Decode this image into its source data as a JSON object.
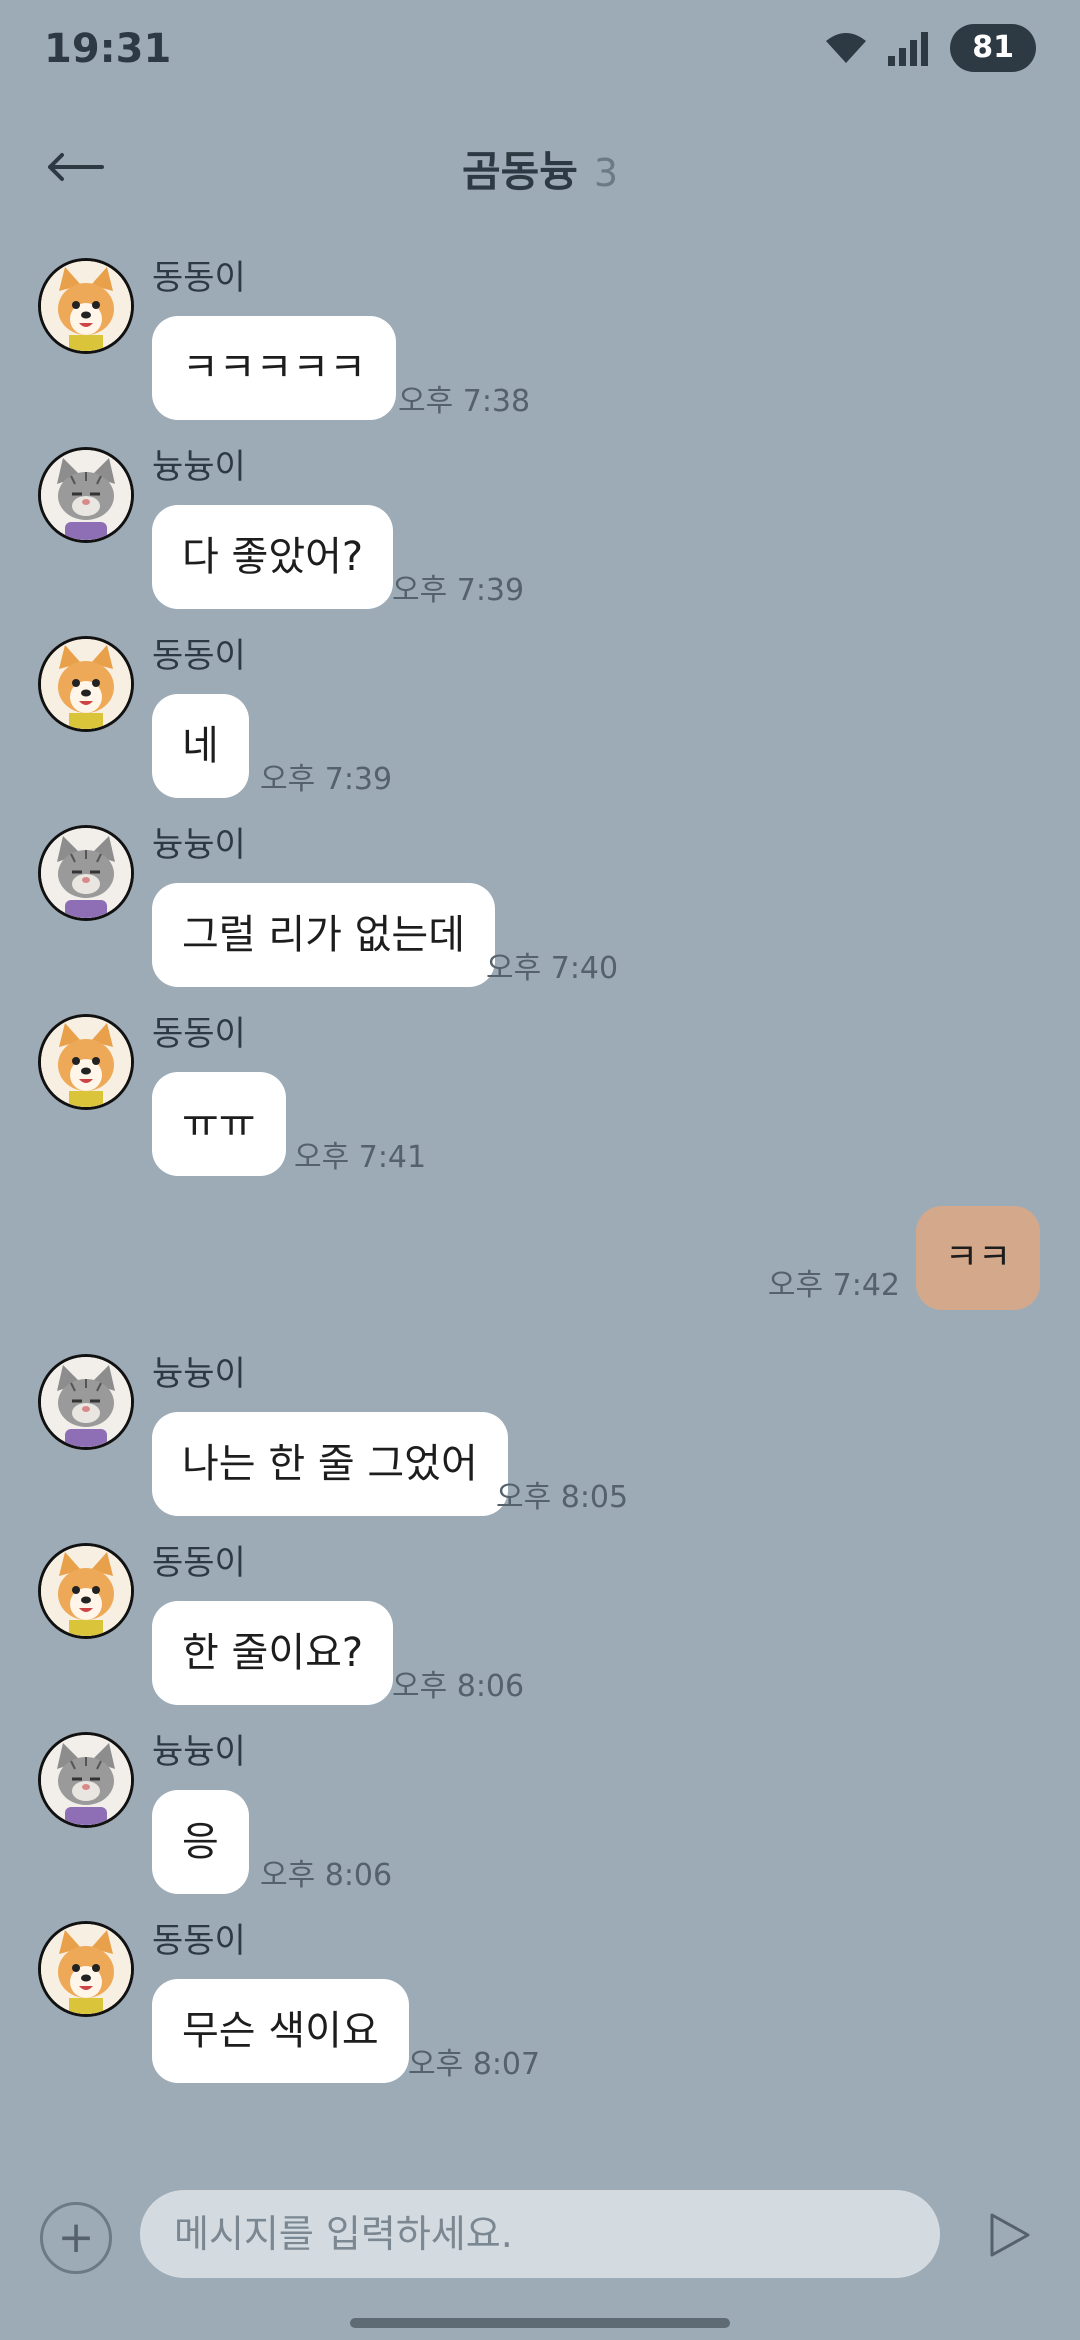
{
  "status_bar": {
    "time": "19:31",
    "battery": "81",
    "icons": [
      "wifi-icon",
      "signal-icon"
    ]
  },
  "header": {
    "back_icon": "arrow-left-icon",
    "title": "곰동늉",
    "member_count": "3"
  },
  "colors": {
    "background": "#9dabb6",
    "bubble_other": "#ffffff",
    "bubble_own": "#d4a98b",
    "input_bg": "#d3dbe1"
  },
  "messages": [
    {
      "sender": "동동이",
      "avatar": "dog-avatar",
      "text": "ㅋㅋㅋㅋㅋ",
      "time": "오후 7:38"
    },
    {
      "sender": "늉늉이",
      "avatar": "cat-avatar",
      "text": "다 좋았어?",
      "time": "오후 7:39"
    },
    {
      "sender": "동동이",
      "avatar": "dog-avatar",
      "text": "네",
      "time": "오후 7:39"
    },
    {
      "sender": "늉늉이",
      "avatar": "cat-avatar",
      "text": "그럴 리가 없는데",
      "time": "오후 7:40"
    },
    {
      "sender": "동동이",
      "avatar": "dog-avatar",
      "text": "ㅠㅠ",
      "time": "오후 7:41"
    },
    {
      "own": true,
      "text": "ㅋㅋ",
      "time": "오후 7:42"
    },
    {
      "sender": "늉늉이",
      "avatar": "cat-avatar",
      "text": "나는 한 줄 그었어",
      "time": "오후 8:05"
    },
    {
      "sender": "동동이",
      "avatar": "dog-avatar",
      "text": "한 줄이요?",
      "time": "오후 8:06"
    },
    {
      "sender": "늉늉이",
      "avatar": "cat-avatar",
      "text": "응",
      "time": "오후 8:06"
    },
    {
      "sender": "동동이",
      "avatar": "dog-avatar",
      "text": "무슨 색이요",
      "time": "오후 8:07"
    }
  ],
  "input": {
    "plus_label": "+",
    "placeholder": "메시지를 입력하세요.",
    "send_icon": "send-icon"
  }
}
